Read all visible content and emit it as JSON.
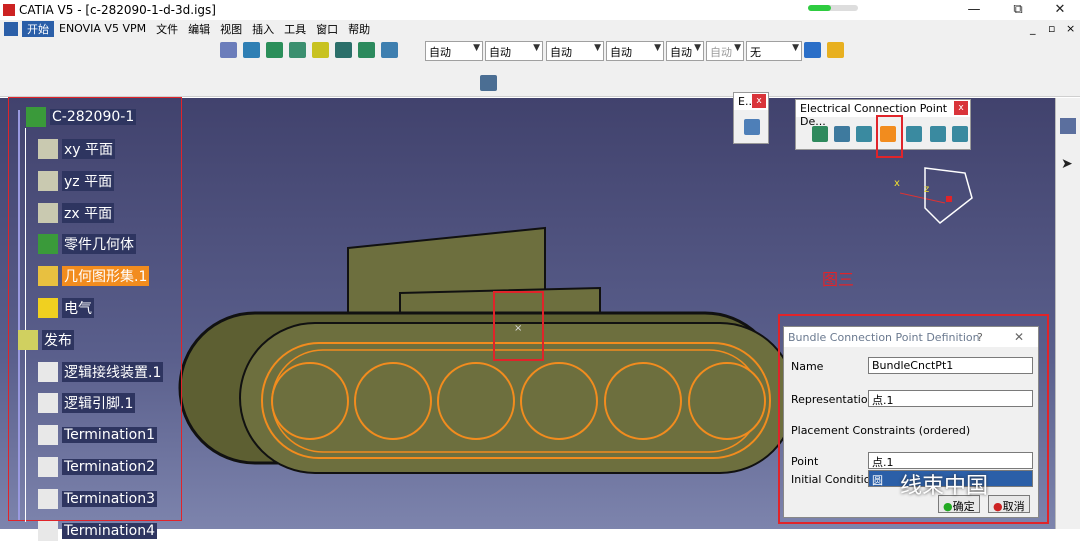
{
  "window": {
    "title": "CATIA V5 - [c-282090-1-d-3d.igs]",
    "min": "—",
    "restore": "⧉",
    "close": "✕",
    "sub_min": "_",
    "sub_restore": "▫",
    "sub_close": "×"
  },
  "progress": 0.45,
  "menu": [
    "开始",
    "ENOVIA V5 VPM",
    "文件",
    "编辑",
    "视图",
    "插入",
    "工具",
    "窗口",
    "帮助"
  ],
  "combos": [
    "自动",
    "自动",
    "自动",
    "自动",
    "自动",
    "自动",
    "无"
  ],
  "tree": {
    "root": "C-282090-1",
    "items": [
      "xy 平面",
      "yz 平面",
      "zx 平面",
      "零件几何体",
      "几何图形集.1",
      "电气",
      "发布",
      "逻辑接线装置.1",
      "逻辑引脚.1",
      "Termination1",
      "Termination2",
      "Termination3",
      "Termination4"
    ]
  },
  "panel_e": {
    "title": "E...",
    "close": "x"
  },
  "panel_ecp": {
    "title": "Electrical Connection Point De...",
    "close": "x"
  },
  "annotation": "图三",
  "dialog": {
    "title": "Bundle Connection Point Definition",
    "help": "?",
    "close": "✕",
    "name_label": "Name",
    "name_value": "BundleCnctPt1",
    "rep_label": "Representation",
    "rep_value": "点.1",
    "placement_label": "Placement Constraints (ordered)",
    "point_label": "Point",
    "point_value": "点.1",
    "initcond_label": "Initial Condition",
    "initcond_value": "圆",
    "ok": "确定",
    "cancel": "取消"
  },
  "watermark": "线束中国",
  "colors": {
    "accent": "#f28c1e",
    "red": "#e0242a",
    "model": "#6d6f3e"
  }
}
